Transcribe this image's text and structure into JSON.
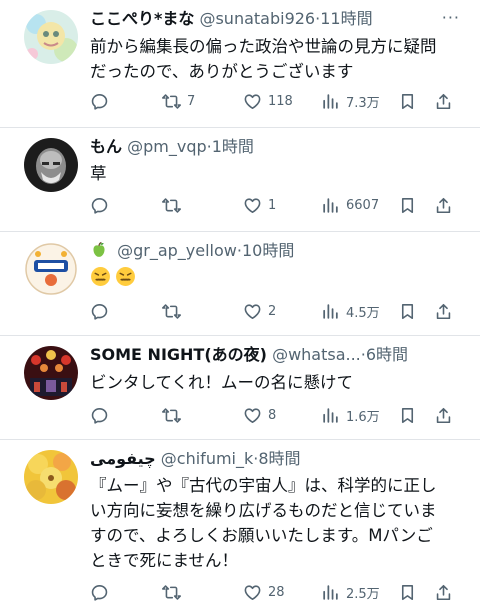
{
  "tweets": [
    {
      "name": "ここぺり*まな",
      "handle": "@sunatabi926",
      "time": "11時間",
      "lines": [
        "前から編集長の偏った政治や世論の見方に疑問",
        "だったので、ありがとうございます"
      ],
      "replies": "",
      "retweets": "7",
      "likes": "118",
      "views": "7.3万"
    },
    {
      "name": "もん",
      "handle": "@pm_vqp",
      "time": "1時間",
      "lines": [
        "草"
      ],
      "replies": "",
      "retweets": "",
      "likes": "1",
      "views": "6607"
    },
    {
      "name": "",
      "handle": "@gr_ap_yellow",
      "time": "10時間",
      "lines": [],
      "replies": "",
      "retweets": "",
      "likes": "2",
      "views": "4.5万"
    },
    {
      "name": "SOME NIGHT(あの夜)",
      "handle": "@whatsa...",
      "time": "6時間",
      "lines": [
        "ビンタしてくれ！ムーの名に懸けて"
      ],
      "replies": "",
      "retweets": "",
      "likes": "8",
      "views": "1.6万"
    },
    {
      "name": "چیفومی",
      "handle": "@chifumi_k",
      "time": "8時間",
      "lines": [
        "『ムー』や『古代の宇宙人』は、科学的に正し",
        "い方向に妄想を繰り広げるものだと信じていま",
        "すので、よろしくお願いいたします。Mパンご",
        "ときで死にません！"
      ],
      "replies": "",
      "retweets": "",
      "likes": "28",
      "views": "2.5万"
    }
  ],
  "separator": "·",
  "more_label": "···",
  "icons": {
    "reply": "reply-icon",
    "retweet": "retweet-icon",
    "like": "like-icon",
    "views": "views-icon",
    "bookmark": "bookmark-icon",
    "share": "share-icon"
  },
  "colors": {
    "text": "#0f1419",
    "secondary": "#536471",
    "divider": "#e1e4e8",
    "background": "#ffffff"
  }
}
